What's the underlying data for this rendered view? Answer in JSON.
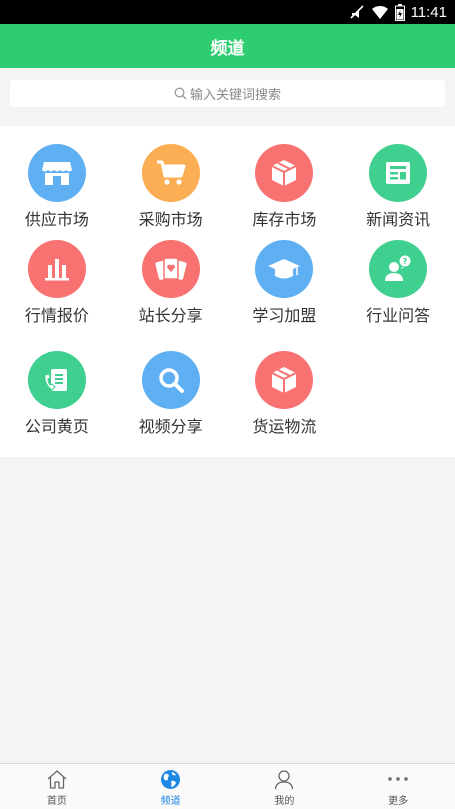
{
  "status_bar": {
    "time": "11:41"
  },
  "header": {
    "title": "频道"
  },
  "search": {
    "placeholder": "输入关键词搜索"
  },
  "channels": [
    {
      "label": "供应市场",
      "icon": "store-icon",
      "color": "#5fb0f2"
    },
    {
      "label": "采购市场",
      "icon": "cart-icon",
      "color": "#fbae53"
    },
    {
      "label": "库存市场",
      "icon": "box-icon",
      "color": "#f87272"
    },
    {
      "label": "新闻资讯",
      "icon": "news-icon",
      "color": "#3fcf8f"
    },
    {
      "label": "行情报价",
      "icon": "bar-chart-icon",
      "color": "#f87272"
    },
    {
      "label": "站长分享",
      "icon": "cards-icon",
      "color": "#f87272"
    },
    {
      "label": "学习加盟",
      "icon": "graduation-cap-icon",
      "color": "#5fb0f2"
    },
    {
      "label": "行业问答",
      "icon": "question-person-icon",
      "color": "#3fcf8f"
    },
    {
      "label": "公司黄页",
      "icon": "phone-book-icon",
      "color": "#3fcf8f"
    },
    {
      "label": "视频分享",
      "icon": "magnifier-icon",
      "color": "#5fb0f2"
    },
    {
      "label": "货运物流",
      "icon": "box-icon",
      "color": "#f87272"
    }
  ],
  "bottom_nav": {
    "items": [
      {
        "label": "首页",
        "icon": "home-icon",
        "active": false
      },
      {
        "label": "频道",
        "icon": "globe-icon",
        "active": true
      },
      {
        "label": "我的",
        "icon": "user-icon",
        "active": false
      },
      {
        "label": "更多",
        "icon": "more-dots-icon",
        "active": false
      }
    ],
    "active_color": "#1e88e5"
  }
}
